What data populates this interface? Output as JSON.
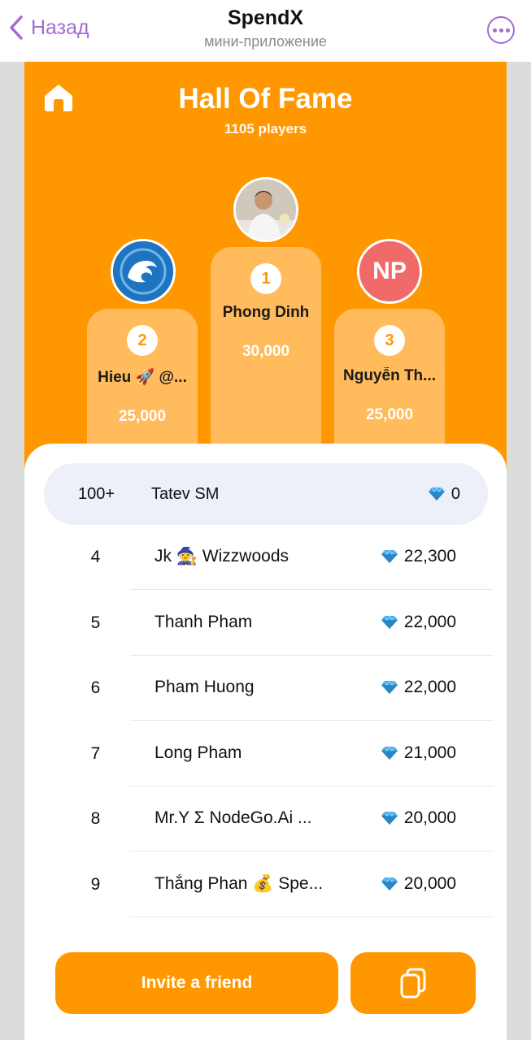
{
  "header": {
    "back_label": "Назад",
    "title": "SpendX",
    "subtitle": "мини-приложение"
  },
  "hall": {
    "title": "Hall Of Fame",
    "players": "1105 players"
  },
  "podium": {
    "first": {
      "rank": "1",
      "name": "Phong Dinh",
      "score": "30,000"
    },
    "second": {
      "rank": "2",
      "name": "Hieu 🚀 @...",
      "score": "25,000"
    },
    "third": {
      "rank": "3",
      "name": "Nguyễn Th...",
      "score": "25,000",
      "initials": "NP"
    }
  },
  "current_user": {
    "rank": "100+",
    "name": "Tatev SM",
    "score": "0"
  },
  "rows": [
    {
      "rank": "4",
      "name": "Jk 🧙 Wizzwoods",
      "score": "22,300"
    },
    {
      "rank": "5",
      "name": "Thanh Pham",
      "score": "22,000"
    },
    {
      "rank": "6",
      "name": "Pham Huong",
      "score": "22,000"
    },
    {
      "rank": "7",
      "name": "Long Pham",
      "score": "21,000"
    },
    {
      "rank": "8",
      "name": "Mr.Y Σ NodeGo.Ai ...",
      "score": "20,000"
    },
    {
      "rank": "9",
      "name": "Thắng Phan 💰 Spe...",
      "score": "20,000"
    }
  ],
  "buttons": {
    "invite_label": "Invite a friend"
  },
  "icons": {
    "back": "chevron-left-icon",
    "more": "more-dots-icon",
    "home": "home-icon",
    "gem": "gem-icon",
    "copy": "copy-icon"
  },
  "colors": {
    "accent_orange": "#ff9800",
    "podium_orange": "#ffbb5c",
    "telegram_purple": "#a36bd4",
    "row_highlight": "#eef0f9"
  }
}
